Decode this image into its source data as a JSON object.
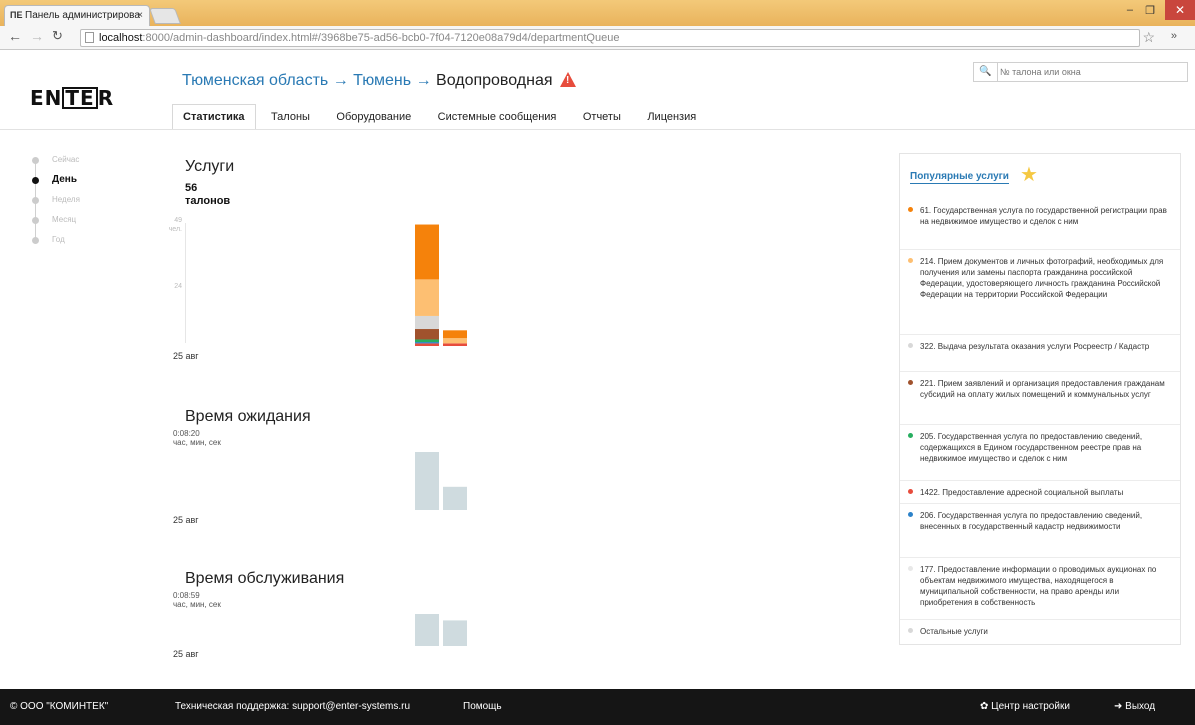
{
  "browser": {
    "tab_title": "Панель администрирова",
    "tab_close": "×",
    "url_host": "localhost",
    "url_rest": ":8000/admin-dashboard/index.html#/3968be75-ad56-bcb0-7f04-7120e08a79d4/departmentQueue"
  },
  "header": {
    "logo": "ENTER",
    "breadcrumb_region": "Тюменская область",
    "breadcrumb_city": "Тюмень",
    "breadcrumb_office": "Водопроводная",
    "arrow": "→",
    "search_placeholder": "№ талона или окна"
  },
  "tabs": [
    {
      "label": "Статистика",
      "active": true
    },
    {
      "label": "Талоны",
      "active": false
    },
    {
      "label": "Оборудование",
      "active": false
    },
    {
      "label": "Системные сообщения",
      "active": false
    },
    {
      "label": "Отчеты",
      "active": false
    },
    {
      "label": "Лицензия",
      "active": false
    }
  ],
  "periods": [
    {
      "label": "Сейчас",
      "active": false
    },
    {
      "label": "День",
      "active": true
    },
    {
      "label": "Неделя",
      "active": false
    },
    {
      "label": "Месяц",
      "active": false
    },
    {
      "label": "Год",
      "active": false
    }
  ],
  "services": {
    "title": "Услуги",
    "count": "56",
    "count_unit": "талонов",
    "axis_max": "49",
    "axis_unit": "чел.",
    "axis_mid": "24",
    "date": "25 авг"
  },
  "wait": {
    "title": "Время ожидания",
    "value": "0:08:20",
    "unit": "час, мин, сек",
    "date": "25 авг"
  },
  "serve": {
    "title": "Время обслуживания",
    "value": "0:08:59",
    "unit": "час, мин, сек",
    "date": "25 авг"
  },
  "chart_data": [
    {
      "type": "bar",
      "stacked": true,
      "categories": [
        "",
        ""
      ],
      "ylim": [
        0,
        49
      ],
      "series": [
        {
          "color": "#e74c3c",
          "values": [
            1,
            1
          ]
        },
        {
          "color": "#2c82c9",
          "values": [
            0.5,
            0
          ]
        },
        {
          "color": "#27ae60",
          "values": [
            1,
            0
          ]
        },
        {
          "color": "#a0522d",
          "values": [
            4,
            0
          ]
        },
        {
          "color": "#d8d8d8",
          "values": [
            5,
            0
          ]
        },
        {
          "color": "#fdbf72",
          "values": [
            14,
            2
          ]
        },
        {
          "color": "#f5820b",
          "values": [
            21,
            3
          ]
        }
      ]
    },
    {
      "type": "bar",
      "categories": [
        "",
        ""
      ],
      "values": [
        1.0,
        0.4
      ]
    },
    {
      "type": "bar",
      "categories": [
        "",
        ""
      ],
      "values": [
        1.0,
        0.8
      ]
    }
  ],
  "popular": {
    "title": "Популярные услуги",
    "items": [
      {
        "text": "61. Государственная услуга по государственной регистрации прав на недвижимое имущество и сделок с ним",
        "color": "#f5820b"
      },
      {
        "text": "214. Прием документов и личных фотографий, необходимых для получения или замены паспорта гражданина российской Федерации, удостоверяющего личность гражданина Российской Федерации на территории Российской Федерации",
        "color": "#fdbf72"
      },
      {
        "text": "322. Выдача результата оказания услуги Росреестр / Кадастр",
        "color": "#d8d8d8"
      },
      {
        "text": "221. Прием заявлений и организация предоставления гражданам субсидий на оплату жилых помещений и коммунальных услуг",
        "color": "#a0522d"
      },
      {
        "text": "205. Государственная услуга по предоставлению сведений, содержащихся в Едином государственном реестре прав на недвижимое имущество и сделок с ним",
        "color": "#27ae60"
      },
      {
        "text": "1422. Предоставление адресной социальной выплаты",
        "color": "#e74c3c"
      },
      {
        "text": "206. Государственная услуга по предоставлению сведений, внесенных в государственный кадастр недвижимости",
        "color": "#2c82c9"
      },
      {
        "text": "177. Предоставление информации о проводимых аукционах по объектам недвижимого имущества, находящегося в муниципальной собственности, на право аренды или приобретения в собственность",
        "color": "#e8e8e8"
      },
      {
        "text": "Остальные услуги",
        "color": "#d8d8d8"
      }
    ]
  },
  "footer": {
    "copyright": "© ООО \"КОМИНТЕК\"",
    "support": "Техническая поддержка: support@enter-systems.ru",
    "help": "Помощь",
    "settings": "Центр настройки",
    "logout": "Выход"
  }
}
